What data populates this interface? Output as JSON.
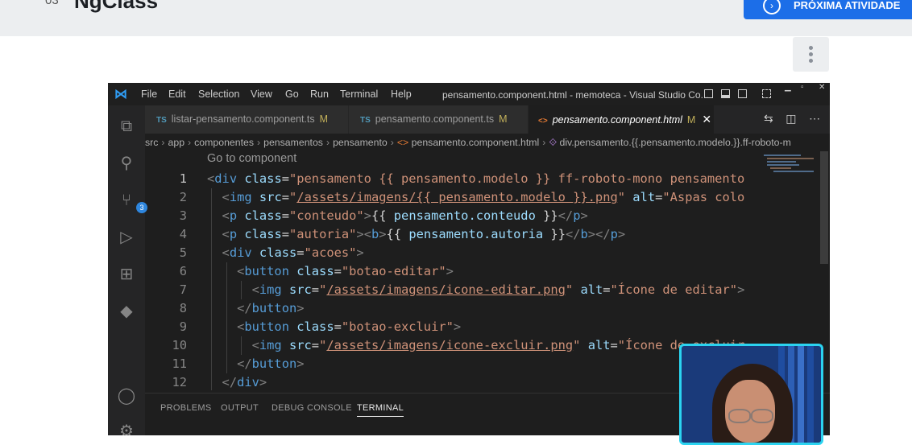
{
  "lesson": {
    "number": "03",
    "title": "NgClass",
    "next_button_label": "PRÓXIMA ATIVIDADE",
    "next_icon": "arrow-circle-right-icon",
    "options_icon": "kebab-menu-icon"
  },
  "vscode": {
    "menu": [
      "File",
      "Edit",
      "Selection",
      "View",
      "Go",
      "Run",
      "Terminal",
      "Help"
    ],
    "window_title": "pensamento.component.html - memoteca - Visual Studio Co...",
    "window_controls": [
      "minimize",
      "maximize",
      "close"
    ],
    "activity_bar": [
      {
        "icon": "explorer-icon"
      },
      {
        "icon": "search-icon"
      },
      {
        "icon": "source-control-icon",
        "badge": "3"
      },
      {
        "icon": "run-debug-icon"
      },
      {
        "icon": "extensions-icon"
      },
      {
        "icon": "angular-icon"
      },
      {
        "icon": "account-icon"
      },
      {
        "icon": "settings-gear-icon"
      }
    ],
    "tabs": [
      {
        "type": "TS",
        "label": "listar-pensamento.component.ts",
        "modified": "M"
      },
      {
        "type": "TS",
        "label": "pensamento.component.ts",
        "modified": "M"
      },
      {
        "type": "<>",
        "label": "pensamento.component.html",
        "modified": "M",
        "active": true
      }
    ],
    "breadcrumb": [
      "src",
      "app",
      "componentes",
      "pensamentos",
      "pensamento",
      "pensamento.component.html",
      "div.pensamento.{{.pensamento.modelo.}}.ff-roboto-m"
    ],
    "goto_hint": "Go to component",
    "line_numbers": [
      "1",
      "2",
      "3",
      "4",
      "5",
      "6",
      "7",
      "8",
      "9",
      "10",
      "11",
      "12"
    ],
    "active_line": "1",
    "code_lines": [
      "<div class=\"pensamento {{ pensamento.modelo }} ff-roboto-mono pensamento",
      "  <img src=\"/assets/imagens/{{ pensamento.modelo }}.png\" alt=\"Aspas colo",
      "  <p class=\"conteudo\">{{ pensamento.conteudo }}</p>",
      "  <p class=\"autoria\"><b>{{ pensamento.autoria }}</b></p>",
      "  <div class=\"acoes\">",
      "    <button class=\"botao-editar\">",
      "      <img src=\"/assets/imagens/icone-editar.png\" alt=\"Ícone de editar\">",
      "    </button>",
      "    <button class=\"botao-excluir\">",
      "      <img src=\"/assets/imagens/icone-excluir.png\" alt=\"Ícone de excluir",
      "    </button>",
      "  </div>"
    ],
    "panel_tabs": [
      "PROBLEMS",
      "OUTPUT",
      "DEBUG CONSOLE",
      "TERMINAL"
    ],
    "active_panel_tab": "TERMINAL",
    "colors": {
      "tag": "#569cd6",
      "attr": "#9cdcfe",
      "string": "#ce9178",
      "accent": "#1c6ee8",
      "webcam_border": "#2bd3f0"
    }
  }
}
